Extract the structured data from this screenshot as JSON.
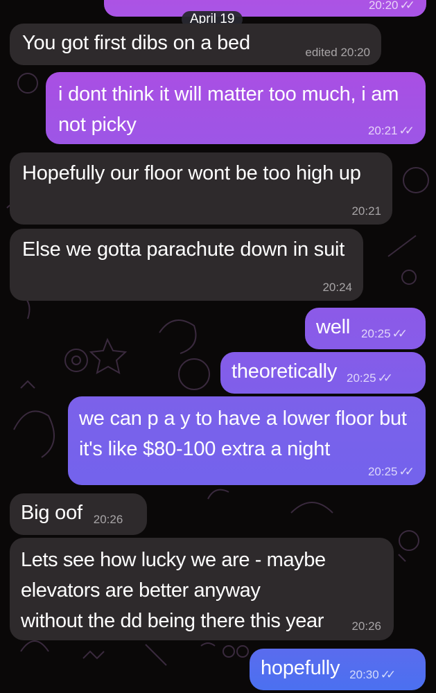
{
  "chat": {
    "top_partial_time": "20:20",
    "date_label": "April 19",
    "check_glyph": "✓✓",
    "colors": {
      "incoming_bubble": "#2e2a2c",
      "outgoing_bubble_top": "#9b52dc",
      "outgoing_bubble_bottom": "#4b6ff0",
      "background": "#0a0808"
    },
    "messages": [
      {
        "id": "m1",
        "direction": "incoming",
        "text": "You got first dibs on a bed",
        "edited": "edited",
        "time": "20:20"
      },
      {
        "id": "m2",
        "direction": "outgoing",
        "text": "i dont think it will matter too much, i am not picky",
        "time": "20:21",
        "status": "read"
      },
      {
        "id": "m3",
        "direction": "incoming",
        "text": "Hopefully our floor wont be too high up",
        "time": "20:21"
      },
      {
        "id": "m4",
        "direction": "incoming",
        "text": "Else we gotta parachute down in suit",
        "time": "20:24"
      },
      {
        "id": "m5",
        "direction": "outgoing",
        "text": "well",
        "time": "20:25",
        "status": "read"
      },
      {
        "id": "m6",
        "direction": "outgoing",
        "text": "theoretically",
        "time": "20:25",
        "status": "read"
      },
      {
        "id": "m7",
        "direction": "outgoing",
        "text": "we can p a y to have a lower floor but it's like $80-100 extra a night",
        "time": "20:25",
        "status": "read"
      },
      {
        "id": "m8",
        "direction": "incoming",
        "text": "Big oof",
        "time": "20:26"
      },
      {
        "id": "m9",
        "direction": "incoming",
        "text": "Lets see how lucky we are - maybe elevators are better anyway without the dd being there this year",
        "time": "20:26"
      },
      {
        "id": "m10",
        "direction": "outgoing",
        "text": "hopefully",
        "time": "20:30",
        "status": "read"
      }
    ]
  }
}
